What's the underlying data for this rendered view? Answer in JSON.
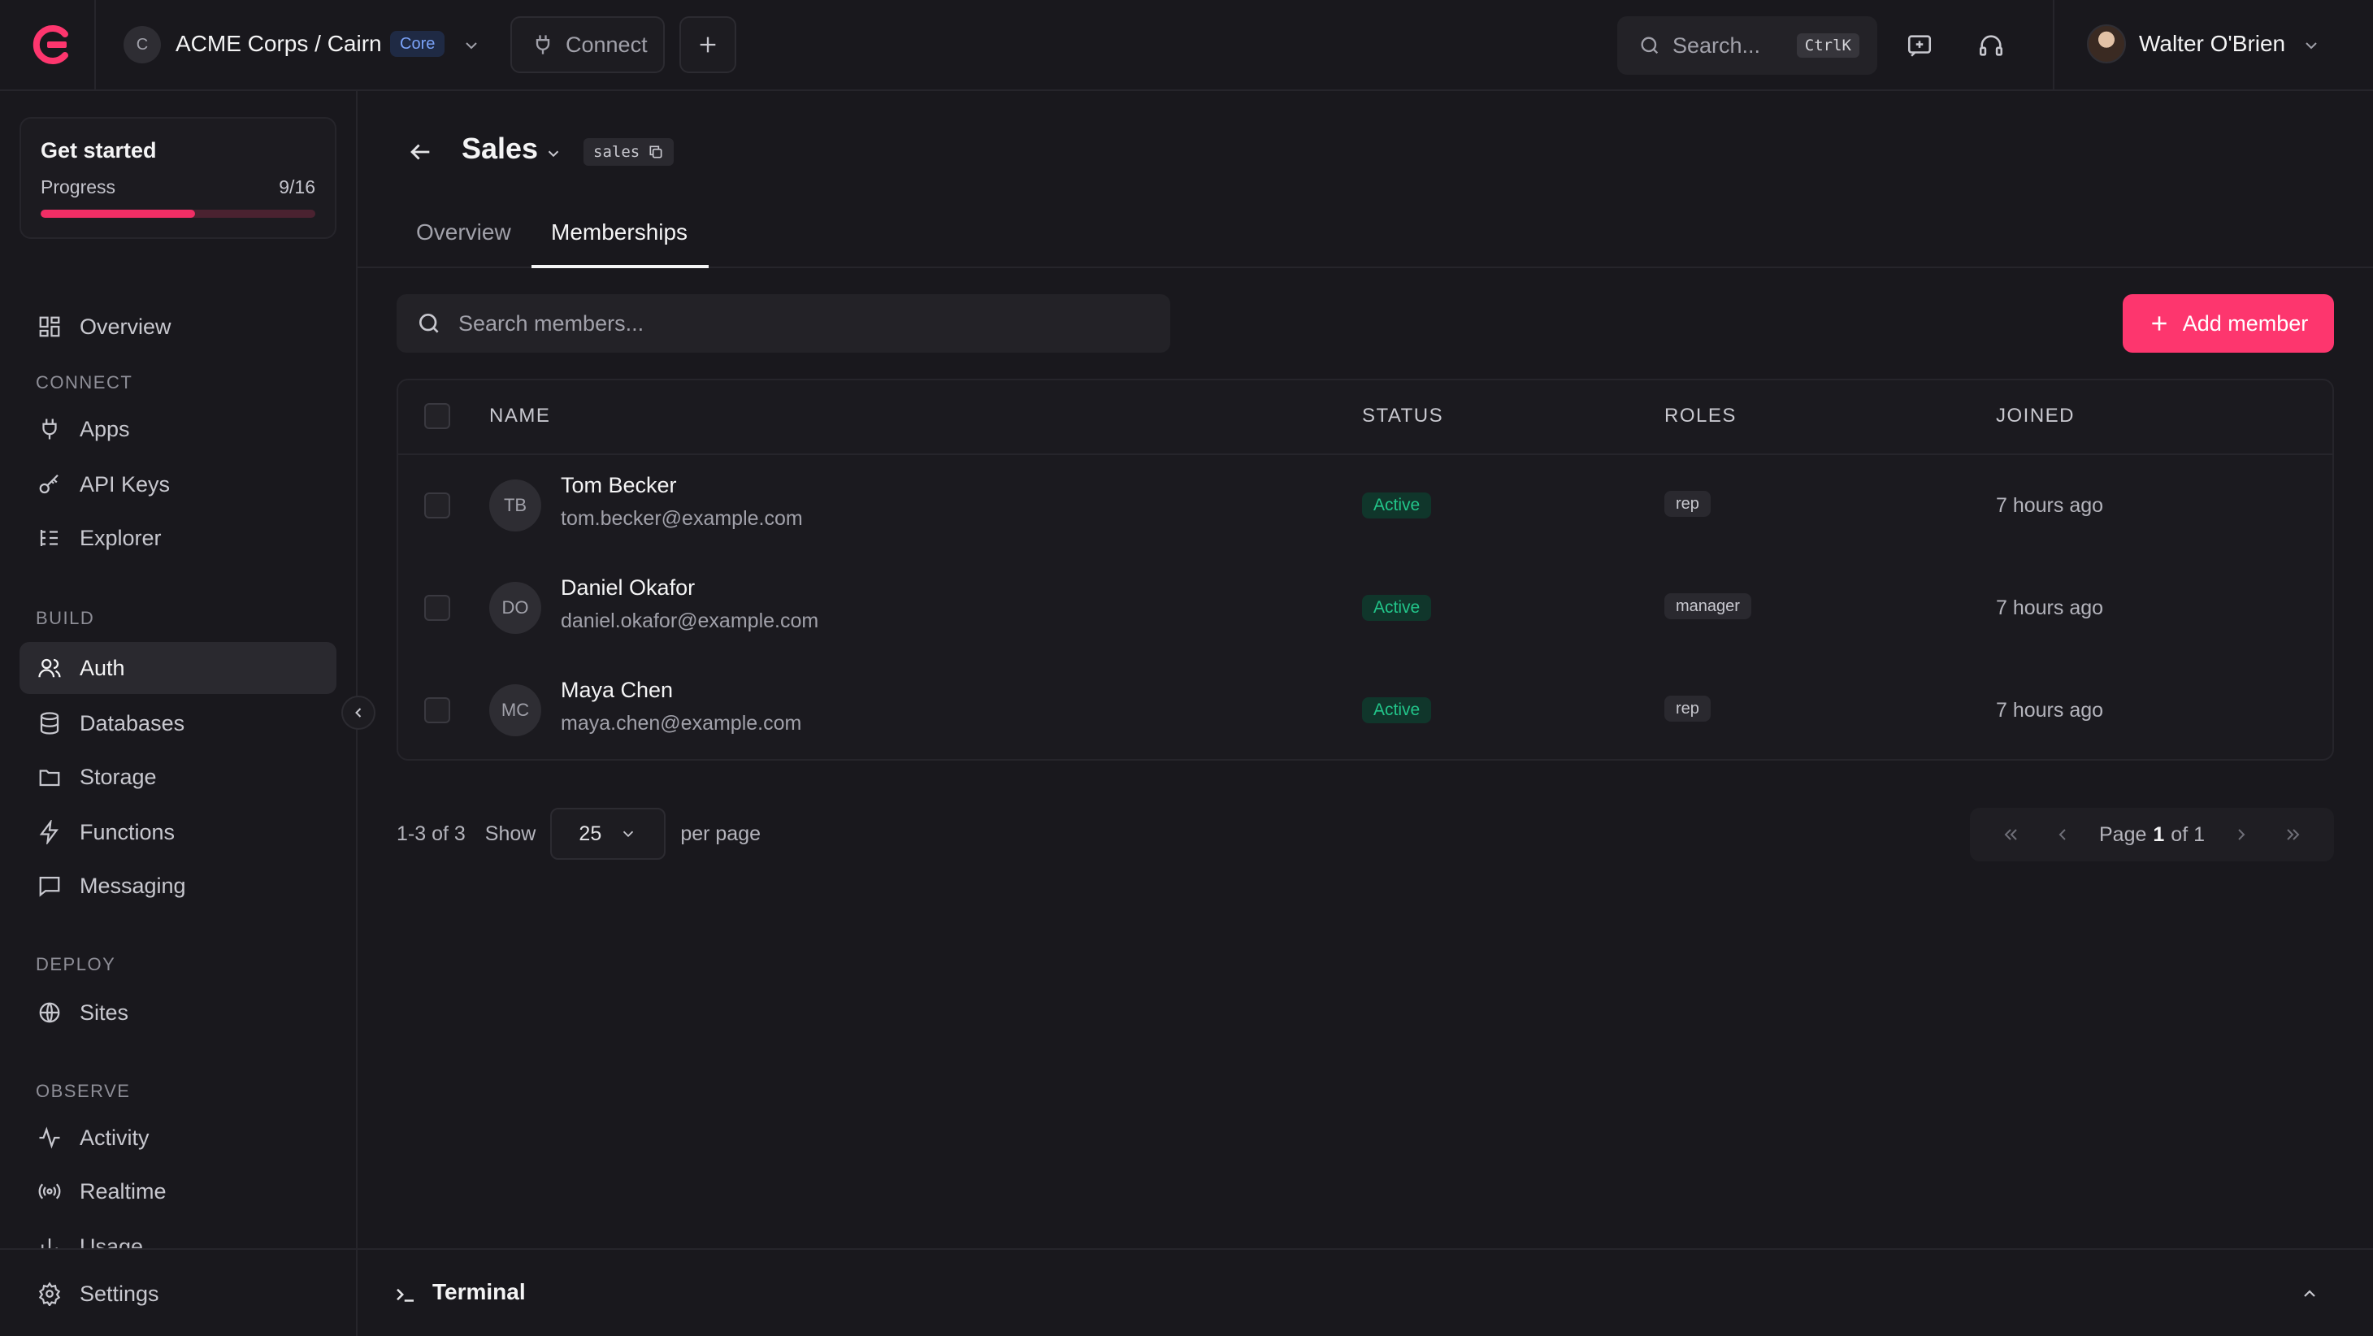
{
  "app": {
    "org_project": "ACME Corps / Cairn",
    "plan_badge": "Core",
    "project_initial": "C",
    "connect_label": "Connect"
  },
  "search": {
    "placeholder": "Search...",
    "shortcut": "CtrlK"
  },
  "user": {
    "name": "Walter O'Brien"
  },
  "sidebar": {
    "get_started": {
      "title": "Get started",
      "progress_label": "Progress",
      "progress_text": "9/16",
      "progress_value": 0.5625
    },
    "overview": "Overview",
    "sections": {
      "connect": "CONNECT",
      "build": "BUILD",
      "deploy": "DEPLOY",
      "observe": "OBSERVE"
    },
    "items": {
      "apps": "Apps",
      "api_keys": "API Keys",
      "explorer": "Explorer",
      "auth": "Auth",
      "databases": "Databases",
      "storage": "Storage",
      "functions": "Functions",
      "messaging": "Messaging",
      "sites": "Sites",
      "activity": "Activity",
      "realtime": "Realtime",
      "usage": "Usage",
      "settings": "Settings"
    }
  },
  "page": {
    "title": "Sales",
    "id_badge": "sales",
    "tabs": [
      "Overview",
      "Memberships"
    ],
    "active_tab": "Memberships"
  },
  "members": {
    "search_placeholder": "Search members...",
    "add_label": "Add member",
    "columns": [
      "NAME",
      "STATUS",
      "ROLES",
      "JOINED"
    ],
    "rows": [
      {
        "initials": "TB",
        "name": "Tom Becker",
        "email": "tom.becker@example.com",
        "status": "Active",
        "role": "rep",
        "joined": "7 hours ago"
      },
      {
        "initials": "DO",
        "name": "Daniel Okafor",
        "email": "daniel.okafor@example.com",
        "status": "Active",
        "role": "manager",
        "joined": "7 hours ago"
      },
      {
        "initials": "MC",
        "name": "Maya Chen",
        "email": "maya.chen@example.com",
        "status": "Active",
        "role": "rep",
        "joined": "7 hours ago"
      }
    ]
  },
  "pagination": {
    "range": "1-3 of 3",
    "show": "Show",
    "per_page_value": "25",
    "per_page": "per page",
    "page_label": "Page",
    "page_current": "1",
    "page_total": "of 1"
  },
  "terminal": {
    "label": "Terminal"
  },
  "colors": {
    "accent": "#fd366e",
    "active_status": "#22c58a",
    "background": "#19181d"
  }
}
